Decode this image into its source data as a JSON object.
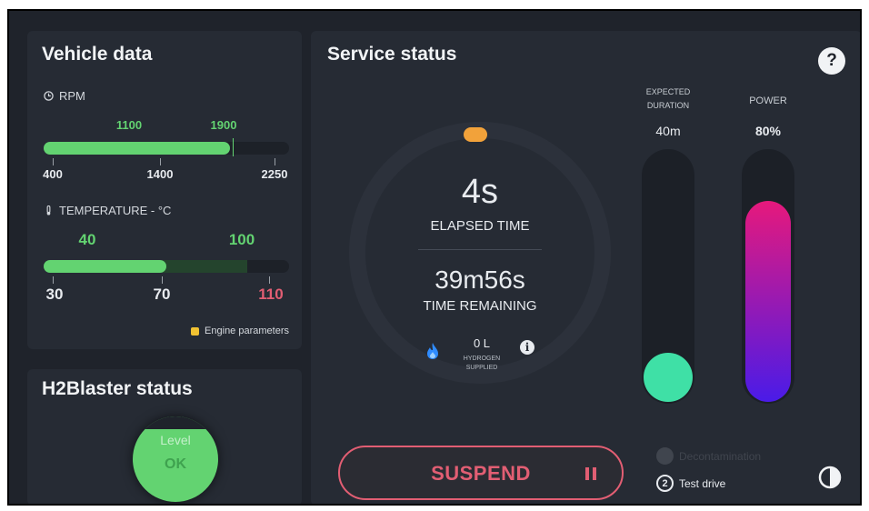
{
  "vehicle": {
    "title": "Vehicle data",
    "rpm": {
      "label": "RPM",
      "range_low": "1100",
      "range_high": "1900",
      "ticks": [
        "400",
        "1400",
        "2250"
      ],
      "value_fraction": 0.76
    },
    "temperature": {
      "label": "TEMPERATURE - °C",
      "range_low": "40",
      "range_high": "100",
      "ticks": [
        "30",
        "70",
        "110"
      ],
      "value_fraction": 0.5
    },
    "engine_link": "Engine parameters"
  },
  "service": {
    "title": "Service status",
    "elapsed_value": "4s",
    "elapsed_label": "ELAPSED TIME",
    "remaining_value": "39m56s",
    "remaining_label": "TIME REMAINING",
    "hydrogen_value": "0 L",
    "hydrogen_label_1": "HYDROGEN",
    "hydrogen_label_2": "SUPPLIED",
    "expected_label_1": "EXPECTED",
    "expected_label_2": "DURATION",
    "expected_value": "40m",
    "expected_fraction": 0.0,
    "power_label": "POWER",
    "power_value": "80%",
    "power_fraction": 0.8,
    "suspend_label": "SUSPEND",
    "step1_label": "Decontamination",
    "step2_num": "2",
    "step2_label": "Test drive"
  },
  "h2blaster": {
    "title": "H2Blaster status",
    "level_label": "Level",
    "level_value": "OK"
  },
  "colors": {
    "accent_green": "#63d371",
    "alert_red": "#e25e73",
    "gauge_dot": "#f2a23a",
    "power_top": "#e6197c",
    "power_bottom": "#4a1be8",
    "teal": "#3fe0a6"
  },
  "icons": [
    "clock-icon",
    "thermometer-icon",
    "flame-icon",
    "info-icon",
    "help-icon",
    "contrast-icon",
    "pause-icon"
  ]
}
